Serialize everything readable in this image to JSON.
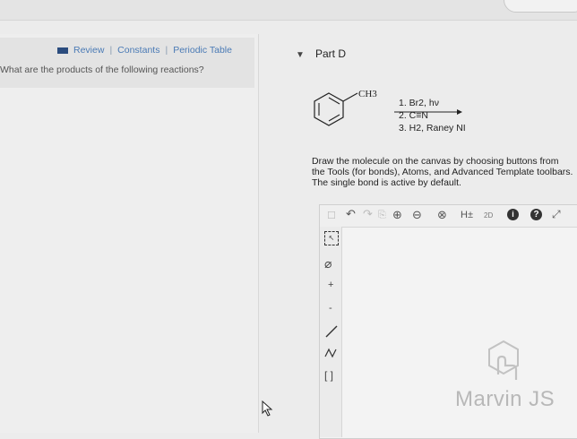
{
  "nav": {
    "review": "Review",
    "constants": "Constants",
    "periodic_table": "Periodic Table",
    "separator": "|"
  },
  "question_text": "What are the products of the following reactions?",
  "part": {
    "title": "Part D"
  },
  "reaction": {
    "substituent": "CH3",
    "step1": "1. Br2, hν",
    "step2": "2. C≡N",
    "step3": "3. H2, Raney NI"
  },
  "instructions": "Draw the molecule on the canvas by choosing buttons from the Tools (for bonds), Atoms, and Advanced Template toolbars. The single bond is active by default.",
  "toolbar": {
    "hydrogen_label": "H±",
    "info_label": "i",
    "help_label": "?",
    "plus_label": "+",
    "minus_label": "-"
  },
  "logo": {
    "text": "Marvin JS"
  }
}
